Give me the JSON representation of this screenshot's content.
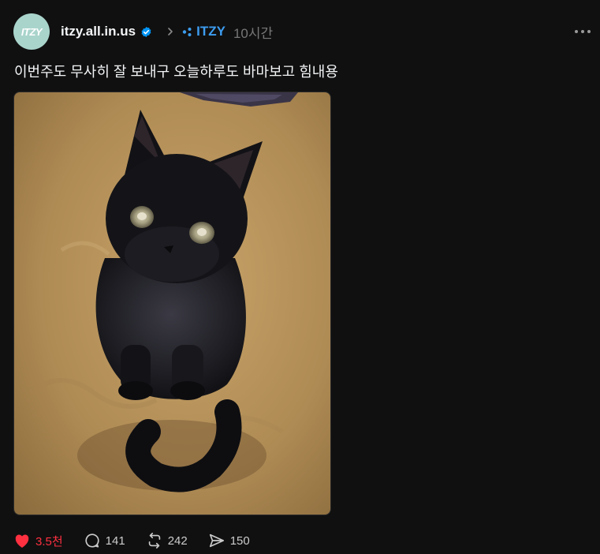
{
  "post": {
    "avatar_text": "ITZY",
    "username": "itzy.all.in.us",
    "community": "ITZY",
    "time": "10시간",
    "caption": "이번주도 무사히 잘 보내구 오늘하루도 바마보고 힘내용"
  },
  "image": {
    "subject": "black cat sitting on beige carpet"
  },
  "actions": {
    "likes": "3.5천",
    "comments": "141",
    "reposts": "242",
    "shares": "150"
  },
  "colors": {
    "background": "#101010",
    "accent_blue": "#3d9df0",
    "like_red": "#ff3040",
    "avatar_bg": "#a9d4cc"
  }
}
